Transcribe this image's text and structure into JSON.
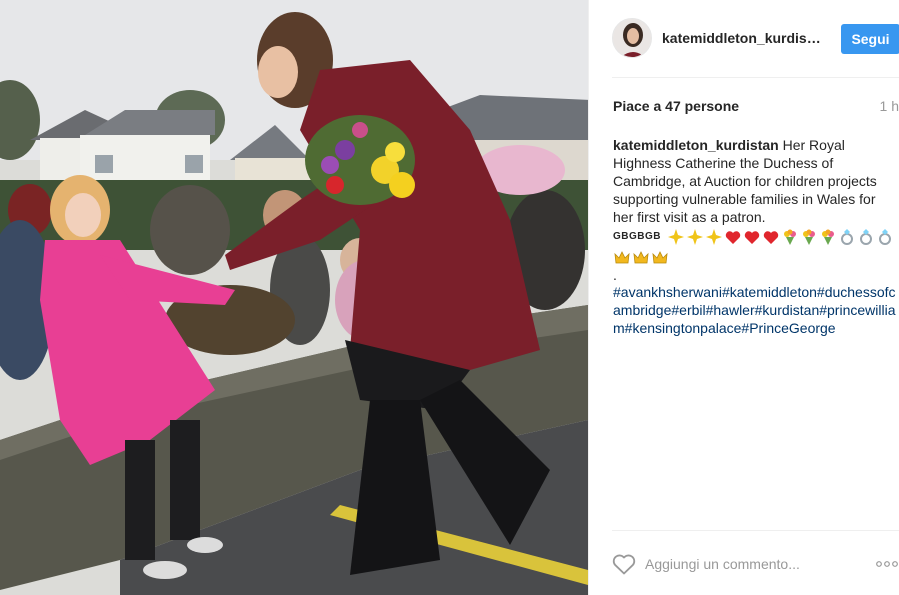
{
  "post": {
    "username": "katemiddleton_kurdist…",
    "follow_label": "Segui",
    "likes_text": "Piace a 47 persone",
    "time_text": "1 h"
  },
  "caption": {
    "user": "katemiddleton_kurdistan",
    "text": "Her Royal Highness Catherine the Duchess of Cambridge, at Auction for children projects supporting vulnerable families in Wales for her first visit as a patron.",
    "flag_text": "GBGBGB",
    "dot": ".",
    "hashtags": "#avankhsherwani#katemiddleton#duchessofcambridge#erbil#hawler#kurdistan#princewilliam#kensingtonpalace#PrinceGeorge"
  },
  "comment": {
    "placeholder": "Aggiungi un commento..."
  },
  "icons": {
    "avatar": "profile-avatar",
    "like": "heart-outline-icon",
    "more": "ellipsis-icon",
    "emoji": [
      "sparkle-icon",
      "heart-icon",
      "bouquet-icon",
      "ring-icon",
      "crown-icon"
    ]
  },
  "colors": {
    "follow_button": "#3897f0",
    "hashtag": "#003569",
    "text": "#262626",
    "muted": "#999999"
  }
}
